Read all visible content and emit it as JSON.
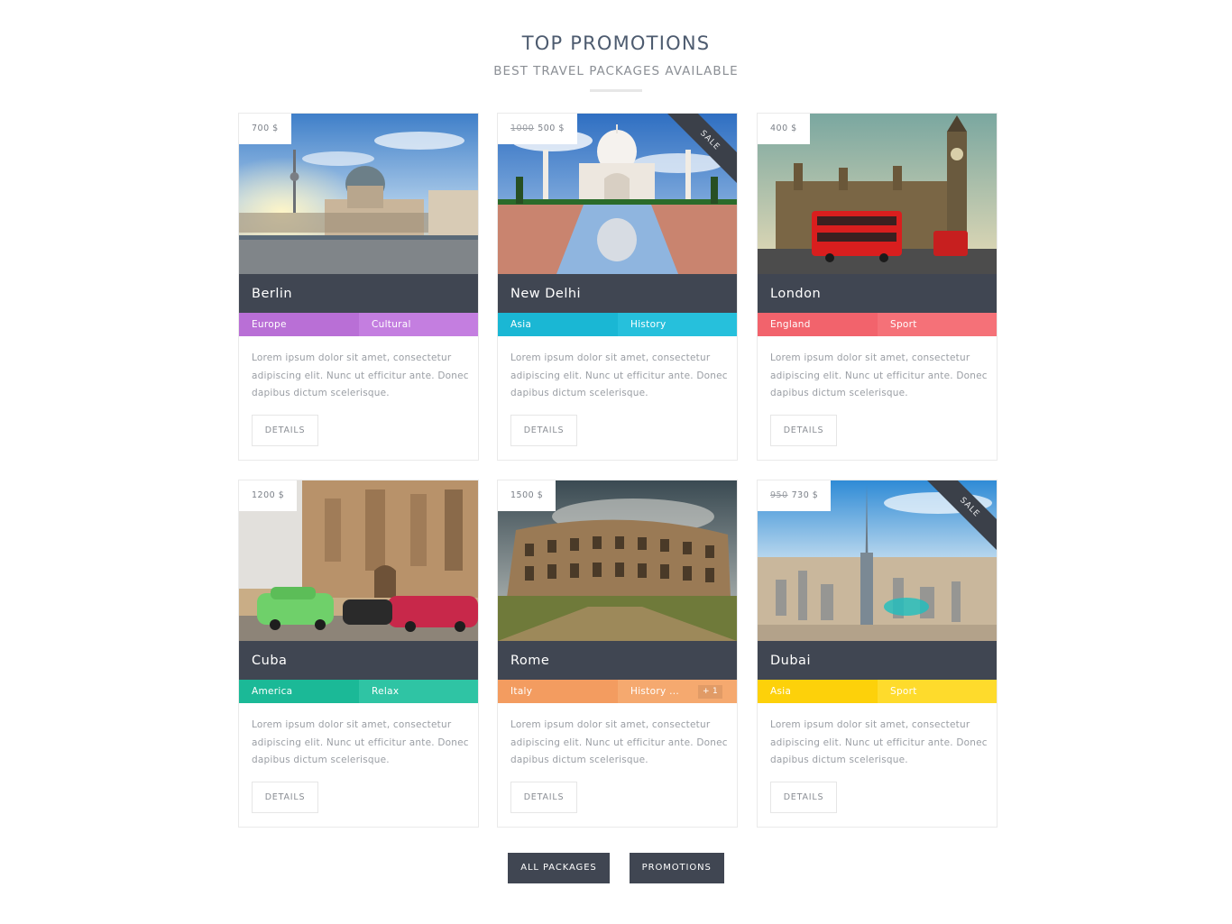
{
  "header": {
    "title": "TOP PROMOTIONS",
    "subtitle": "BEST TRAVEL PACKAGES AVAILABLE"
  },
  "details_label": "DETAILS",
  "description": "Lorem ipsum dolor sit amet, consectetur adipiscing elit. Nunc ut efficitur ante. Donec dapibus dictum scelerisque.",
  "sale_label": "SALE",
  "cards": [
    {
      "name": "Berlin",
      "price": "700 $",
      "old_price": "",
      "sale": false,
      "tag1": "Europe",
      "tag2": "Cultural",
      "more": "",
      "color1": "#b96fd6",
      "color2": "#c47ee0"
    },
    {
      "name": "New Delhi",
      "price": "500 $",
      "old_price": "1000",
      "sale": true,
      "tag1": "Asia",
      "tag2": "History",
      "more": "",
      "color1": "#1ab7d4",
      "color2": "#26c0dc"
    },
    {
      "name": "London",
      "price": "400 $",
      "old_price": "",
      "sale": false,
      "tag1": "England",
      "tag2": "Sport",
      "more": "",
      "color1": "#f2636c",
      "color2": "#f57178"
    },
    {
      "name": "Cuba",
      "price": "1200 $",
      "old_price": "",
      "sale": false,
      "tag1": "America",
      "tag2": "Relax",
      "more": "",
      "color1": "#1bb997",
      "color2": "#2fc4a4"
    },
    {
      "name": "Rome",
      "price": "1500 $",
      "old_price": "",
      "sale": false,
      "tag1": "Italy",
      "tag2": "History ...",
      "more": "+ 1",
      "color1": "#f39c60",
      "color2": "#f5a96f"
    },
    {
      "name": "Dubai",
      "price": "730 $",
      "old_price": "950",
      "sale": true,
      "tag1": "Asia",
      "tag2": "Sport",
      "more": "",
      "color1": "#fdd10a",
      "color2": "#fedb2c"
    }
  ],
  "buttons": {
    "all_packages": "ALL PACKAGES",
    "promotions": "PROMOTIONS"
  }
}
